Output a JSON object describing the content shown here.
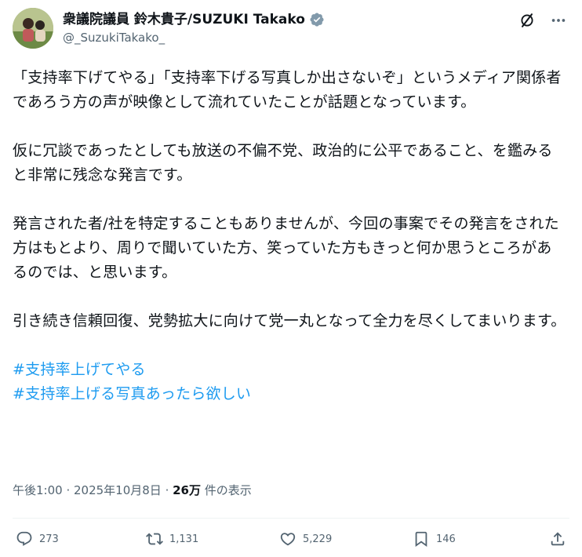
{
  "author": {
    "display_name": "衆議院議員 鈴木貴子/SUZUKI Takako",
    "handle": "@_SuzukiTakako_",
    "verified_icon": "verified-badge-icon"
  },
  "header_actions": {
    "grok_icon": "grok-icon",
    "more_icon": "more-icon"
  },
  "body": {
    "paragraphs": [
      "「支持率下げてやる」「支持率下げる写真しか出さないぞ」というメディア関係者であろう方の声が映像として流れていたことが話題となっています。",
      "仮に冗談であったとしても放送の不偏不党、政治的に公平であること、を鑑みると非常に残念な発言です。",
      "発言された者/社を特定することもありませんが、今回の事案でその発言をされた方はもとより、周りで聞いていた方、笑っていた方もきっと何か思うところがあるのでは、と思います。",
      "引き続き信頼回復、党勢拡大に向けて党一丸となって全力を尽くしてまいります。"
    ],
    "hashtags": [
      "#支持率上げてやる",
      "#支持率上げる写真あったら欲しい"
    ]
  },
  "meta": {
    "time": "午後1:00",
    "sep1": " · ",
    "date": "2025年10月8日",
    "sep2": " · ",
    "views_count": "26万",
    "views_label": " 件の表示"
  },
  "actions": {
    "reply_count": "273",
    "retweet_count": "1,131",
    "like_count": "5,229",
    "bookmark_count": "146"
  },
  "colors": {
    "text": "#0f1419",
    "secondary": "#536471",
    "link": "#1d9bf0",
    "divider": "#eff3f4"
  }
}
